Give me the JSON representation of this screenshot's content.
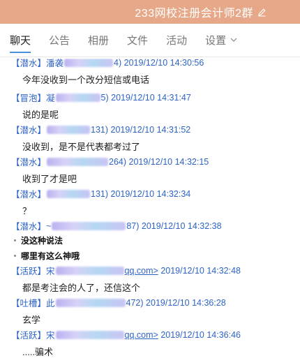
{
  "app": {
    "title": "233网校注册会计师2群",
    "accent": "#e6a888",
    "link_color": "#2e63c7"
  },
  "icons": {
    "edit": "pencil-icon",
    "dropdown": "chevron-down-icon"
  },
  "tabs": [
    {
      "label": "聊天",
      "active": true
    },
    {
      "label": "公告"
    },
    {
      "label": "相册"
    },
    {
      "label": "文件"
    },
    {
      "label": "活动"
    },
    {
      "label": "设置"
    }
  ],
  "messages": [
    {
      "role": "【潜水】",
      "name": "潘袭",
      "uid": "4)",
      "time": "2019/12/10 14:30:56",
      "text": "今年没收到一个改分短信或电话"
    },
    {
      "role": "【冒泡】",
      "name": "凝",
      "uid": "5)",
      "time": "2019/12/10 14:31:47",
      "text": "说的是呢"
    },
    {
      "role": "【潜水】",
      "name": "",
      "uid": "131)",
      "time": "2019/12/10 14:31:52",
      "text": "没收到，是不是代表都考过了"
    },
    {
      "role": "【潜水】",
      "name": "",
      "uid": "264)",
      "time": "2019/12/10 14:32:15",
      "text": "收到了才是吧"
    },
    {
      "role": "【潜水】",
      "name": "",
      "uid": "131)",
      "time": "2019/12/10 14:32:34",
      "text": "？"
    },
    {
      "role": "【潜水】",
      "name": "~",
      "uid": "87)",
      "time": "2019/12/10 14:32:38",
      "bullets": [
        "没这种说法",
        "哪里有这么神哦"
      ]
    },
    {
      "role": "【活跃】",
      "name": "宋",
      "uid": "qq.com>",
      "email": true,
      "time": "2019/12/10 14:32:48",
      "text": "都是考注会的人了，还信这个"
    },
    {
      "role": "【吐槽】",
      "name": "此",
      "uid": "472)",
      "time": "2019/12/10 14:36:28",
      "text": "玄学"
    },
    {
      "role": "【活跃】",
      "name": "宋",
      "uid": "qq.com>",
      "email": true,
      "time": "2019/12/10 14:36:46",
      "text": ".....骗术"
    }
  ]
}
